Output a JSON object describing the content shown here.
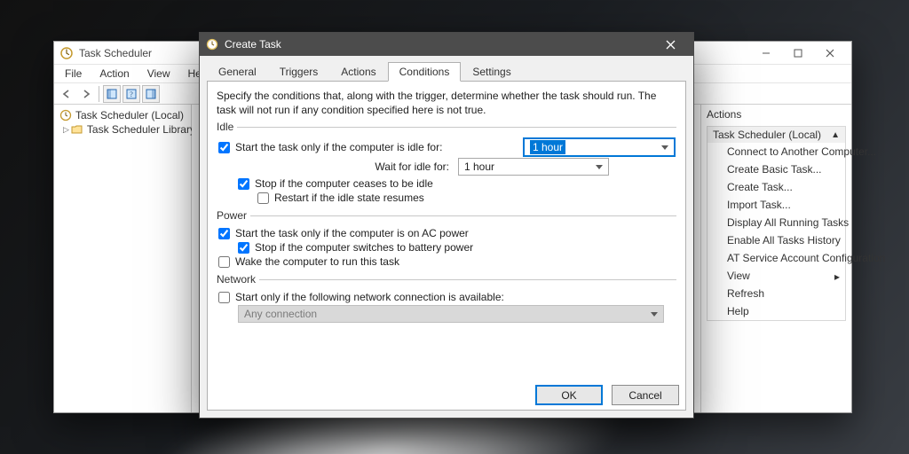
{
  "ts_window": {
    "title": "Task Scheduler",
    "menus": [
      "File",
      "Action",
      "View",
      "Help"
    ],
    "tree": {
      "root": "Task Scheduler (Local)",
      "child": "Task Scheduler Library"
    },
    "actions": {
      "pane_title": "Actions",
      "group_title": "Task Scheduler (Local)",
      "items": [
        "Connect to Another Computer...",
        "Create Basic Task...",
        "Create Task...",
        "Import Task...",
        "Display All Running Tasks",
        "Enable All Tasks History",
        "AT Service Account Configuration",
        "View",
        "Refresh",
        "Help"
      ]
    }
  },
  "dialog": {
    "title": "Create Task",
    "tabs": [
      "General",
      "Triggers",
      "Actions",
      "Conditions",
      "Settings"
    ],
    "active_tab": "Conditions",
    "description": "Specify the conditions that, along with the trigger, determine whether the task should run.  The task will not run  if any condition specified here is not true.",
    "idle": {
      "legend": "Idle",
      "only_if_idle_label": "Start the task only if the computer is idle for:",
      "only_if_idle_checked": true,
      "idle_for_value": "1 hour",
      "wait_label": "Wait for idle for:",
      "wait_value": "1 hour",
      "stop_if_not_idle_label": "Stop if the computer ceases to be idle",
      "stop_if_not_idle_checked": true,
      "restart_label": "Restart if the idle state resumes",
      "restart_checked": false
    },
    "power": {
      "legend": "Power",
      "ac_label": "Start the task only if the computer is on AC power",
      "ac_checked": true,
      "battery_label": "Stop if the computer switches to battery power",
      "battery_checked": true,
      "wake_label": "Wake the computer to run this task",
      "wake_checked": false
    },
    "network": {
      "legend": "Network",
      "only_if_net_label": "Start only if the following network connection is available:",
      "only_if_net_checked": false,
      "connection_value": "Any connection"
    },
    "buttons": {
      "ok": "OK",
      "cancel": "Cancel"
    }
  }
}
